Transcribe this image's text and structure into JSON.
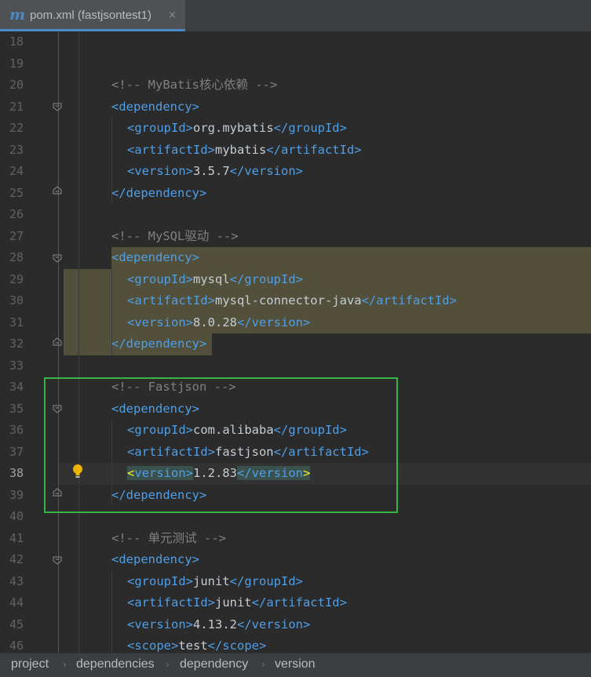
{
  "tab": {
    "icon": "maven-m-icon",
    "icon_glyph": "m",
    "title": "pom.xml (fastjsontest1)",
    "close": "×"
  },
  "lines": [
    {
      "n": "18"
    },
    {
      "n": "19"
    },
    {
      "n": "20",
      "comment": "<!-- MyBatis核心依赖 -->"
    },
    {
      "n": "21",
      "open": "<dependency>"
    },
    {
      "n": "22",
      "open": "<groupId>",
      "text": "org.mybatis",
      "close": "</groupId>"
    },
    {
      "n": "23",
      "open": "<artifactId>",
      "text": "mybatis",
      "close": "</artifactId>"
    },
    {
      "n": "24",
      "open": "<version>",
      "text": "3.5.7",
      "close": "</version>"
    },
    {
      "n": "25",
      "close": "</dependency>"
    },
    {
      "n": "26"
    },
    {
      "n": "27",
      "comment": "<!-- MySQL驱动 -->"
    },
    {
      "n": "28",
      "open": "<dependency>"
    },
    {
      "n": "29",
      "open": "<groupId>",
      "text": "mysql",
      "close": "</groupId>"
    },
    {
      "n": "30",
      "open": "<artifactId>",
      "text": "mysql-connector-java",
      "close": "</artifactId>"
    },
    {
      "n": "31",
      "open": "<version>",
      "text": "8.0.28",
      "close": "</version>"
    },
    {
      "n": "32",
      "close": "</dependency>"
    },
    {
      "n": "33"
    },
    {
      "n": "34",
      "comment": "<!-- Fastjson -->"
    },
    {
      "n": "35",
      "open": "<dependency>"
    },
    {
      "n": "36",
      "open": "<groupId>",
      "text": "com.alibaba",
      "close": "</groupId>"
    },
    {
      "n": "37",
      "open": "<artifactId>",
      "text": "fastjson",
      "close": "</artifactId>"
    },
    {
      "n": "38",
      "lt": "<",
      "open_name": "version>",
      "text": "1.2.83",
      "close_main": "</version",
      "gt": ">"
    },
    {
      "n": "39",
      "close": "</dependency>"
    },
    {
      "n": "40"
    },
    {
      "n": "41",
      "comment": "<!-- 单元测试 -->"
    },
    {
      "n": "42",
      "open": "<dependency>"
    },
    {
      "n": "43",
      "open": "<groupId>",
      "text": "junit",
      "close": "</groupId>"
    },
    {
      "n": "44",
      "open": "<artifactId>",
      "text": "junit",
      "close": "</artifactId>"
    },
    {
      "n": "45",
      "open": "<version>",
      "text": "4.13.2",
      "close": "</version>"
    },
    {
      "n": "46",
      "open": "<scope>",
      "text": "test",
      "close": "</scope>"
    }
  ],
  "breadcrumb": [
    "project",
    "dependencies",
    "dependency",
    "version"
  ],
  "breadcrumb_sep": "›",
  "colors": {
    "tag": "#4f9fe8",
    "text": "#c5ccd3",
    "comment": "#808080",
    "highlight": "#52503a",
    "annotation_box": "#35b546"
  }
}
